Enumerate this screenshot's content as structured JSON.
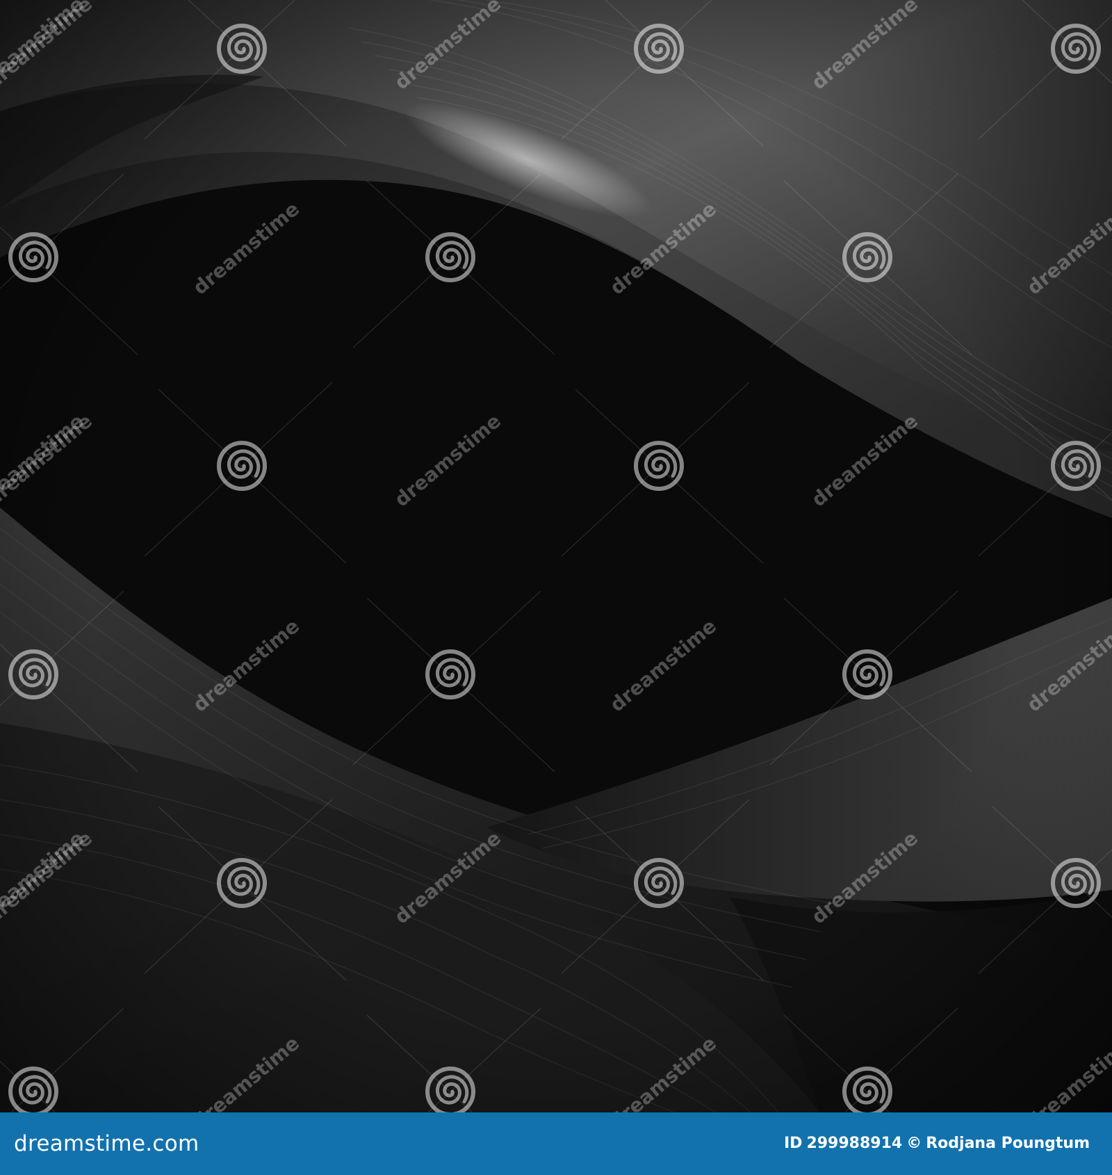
{
  "image": {
    "subject": "abstract dark background with curved grey wave bands of fine lines",
    "colors": {
      "background": "#0b0b0b",
      "wave_light": "#6e6e6e",
      "wave_dark": "#262626",
      "footer": "#1272ad",
      "footer_text": "#ffffff"
    }
  },
  "watermark": {
    "text": "dreamstime",
    "icon": "spiral-logo-icon"
  },
  "footer": {
    "brand": "dreamstime.com",
    "id_label": "ID",
    "image_id": "299988914",
    "copyright_symbol": "©",
    "author": "Rodjana Poungtum"
  }
}
